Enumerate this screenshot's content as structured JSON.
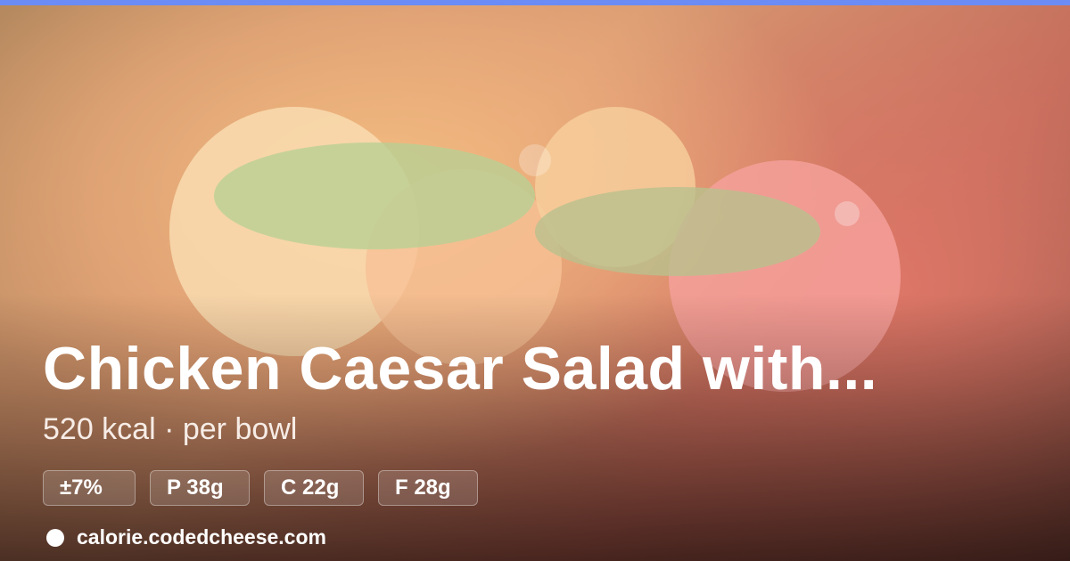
{
  "colors": {
    "accent_bar": "#6b8cf4",
    "background_warm": "#f0b27c",
    "text": "#ffffff"
  },
  "title": "Chicken Caesar Salad with...",
  "subtitle": "520 kcal · per bowl",
  "chips": [
    {
      "label": "±7%"
    },
    {
      "label": "P 38g"
    },
    {
      "label": "C 22g"
    },
    {
      "label": "F 28g"
    }
  ],
  "footer": {
    "icon": "circle-dot-icon",
    "site": "calorie.codedcheese.com"
  }
}
